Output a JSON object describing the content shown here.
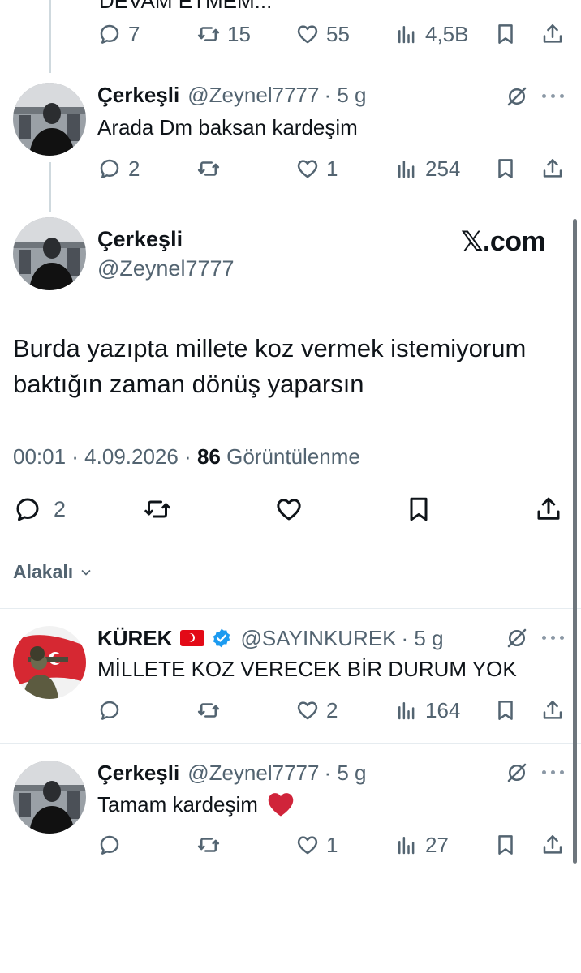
{
  "top_tweet": {
    "cut_text": "DEVAM ETMEM..."
  },
  "top_actions": {
    "replies": "7",
    "retweets": "15",
    "likes": "55",
    "views": "4,5B"
  },
  "reply1": {
    "name": "Çerkeşli",
    "handle": "@Zeynel7777",
    "time": "· 5 g",
    "text": "Arada Dm baksan kardeşim",
    "replies": "2",
    "retweets": "",
    "likes": "1",
    "views": "254"
  },
  "main_tweet": {
    "name": "Çerkeşli",
    "handle": "@Zeynel7777",
    "watermark": "𝕏.com",
    "text": "Burda yazıpta millete koz vermek istemiyorum baktığın zaman dönüş yaparsın",
    "time_date": "00:01 · 4.09.2026 · ",
    "views_count": "86",
    "views_label": " Görüntülenme",
    "replies": "2"
  },
  "sort_label": "Alakalı",
  "reply2": {
    "name": "KÜREK",
    "handle": "@SAYINKUREK",
    "time": "· 5 g",
    "text": "MİLLETE KOZ VERECEK BİR DURUM YOK",
    "replies": "",
    "retweets": "",
    "likes": "2",
    "views": "164"
  },
  "reply3": {
    "name": "Çerkeşli",
    "handle": "@Zeynel7777",
    "time": "· 5 g",
    "text": "Tamam kardeşim",
    "emoji": "❤️",
    "replies": "",
    "retweets": "",
    "likes": "1",
    "views": "27"
  },
  "colors": {
    "text": "#0f1419",
    "secondary": "#536471",
    "verified": "#1d9bf0",
    "heart": "#d0243a"
  },
  "icons": [
    "reply-icon",
    "retweet-icon",
    "like-icon",
    "views-icon",
    "bookmark-icon",
    "share-icon",
    "grok-icon",
    "more-icon",
    "verified-icon",
    "flag-icon",
    "chevron-down-icon"
  ]
}
